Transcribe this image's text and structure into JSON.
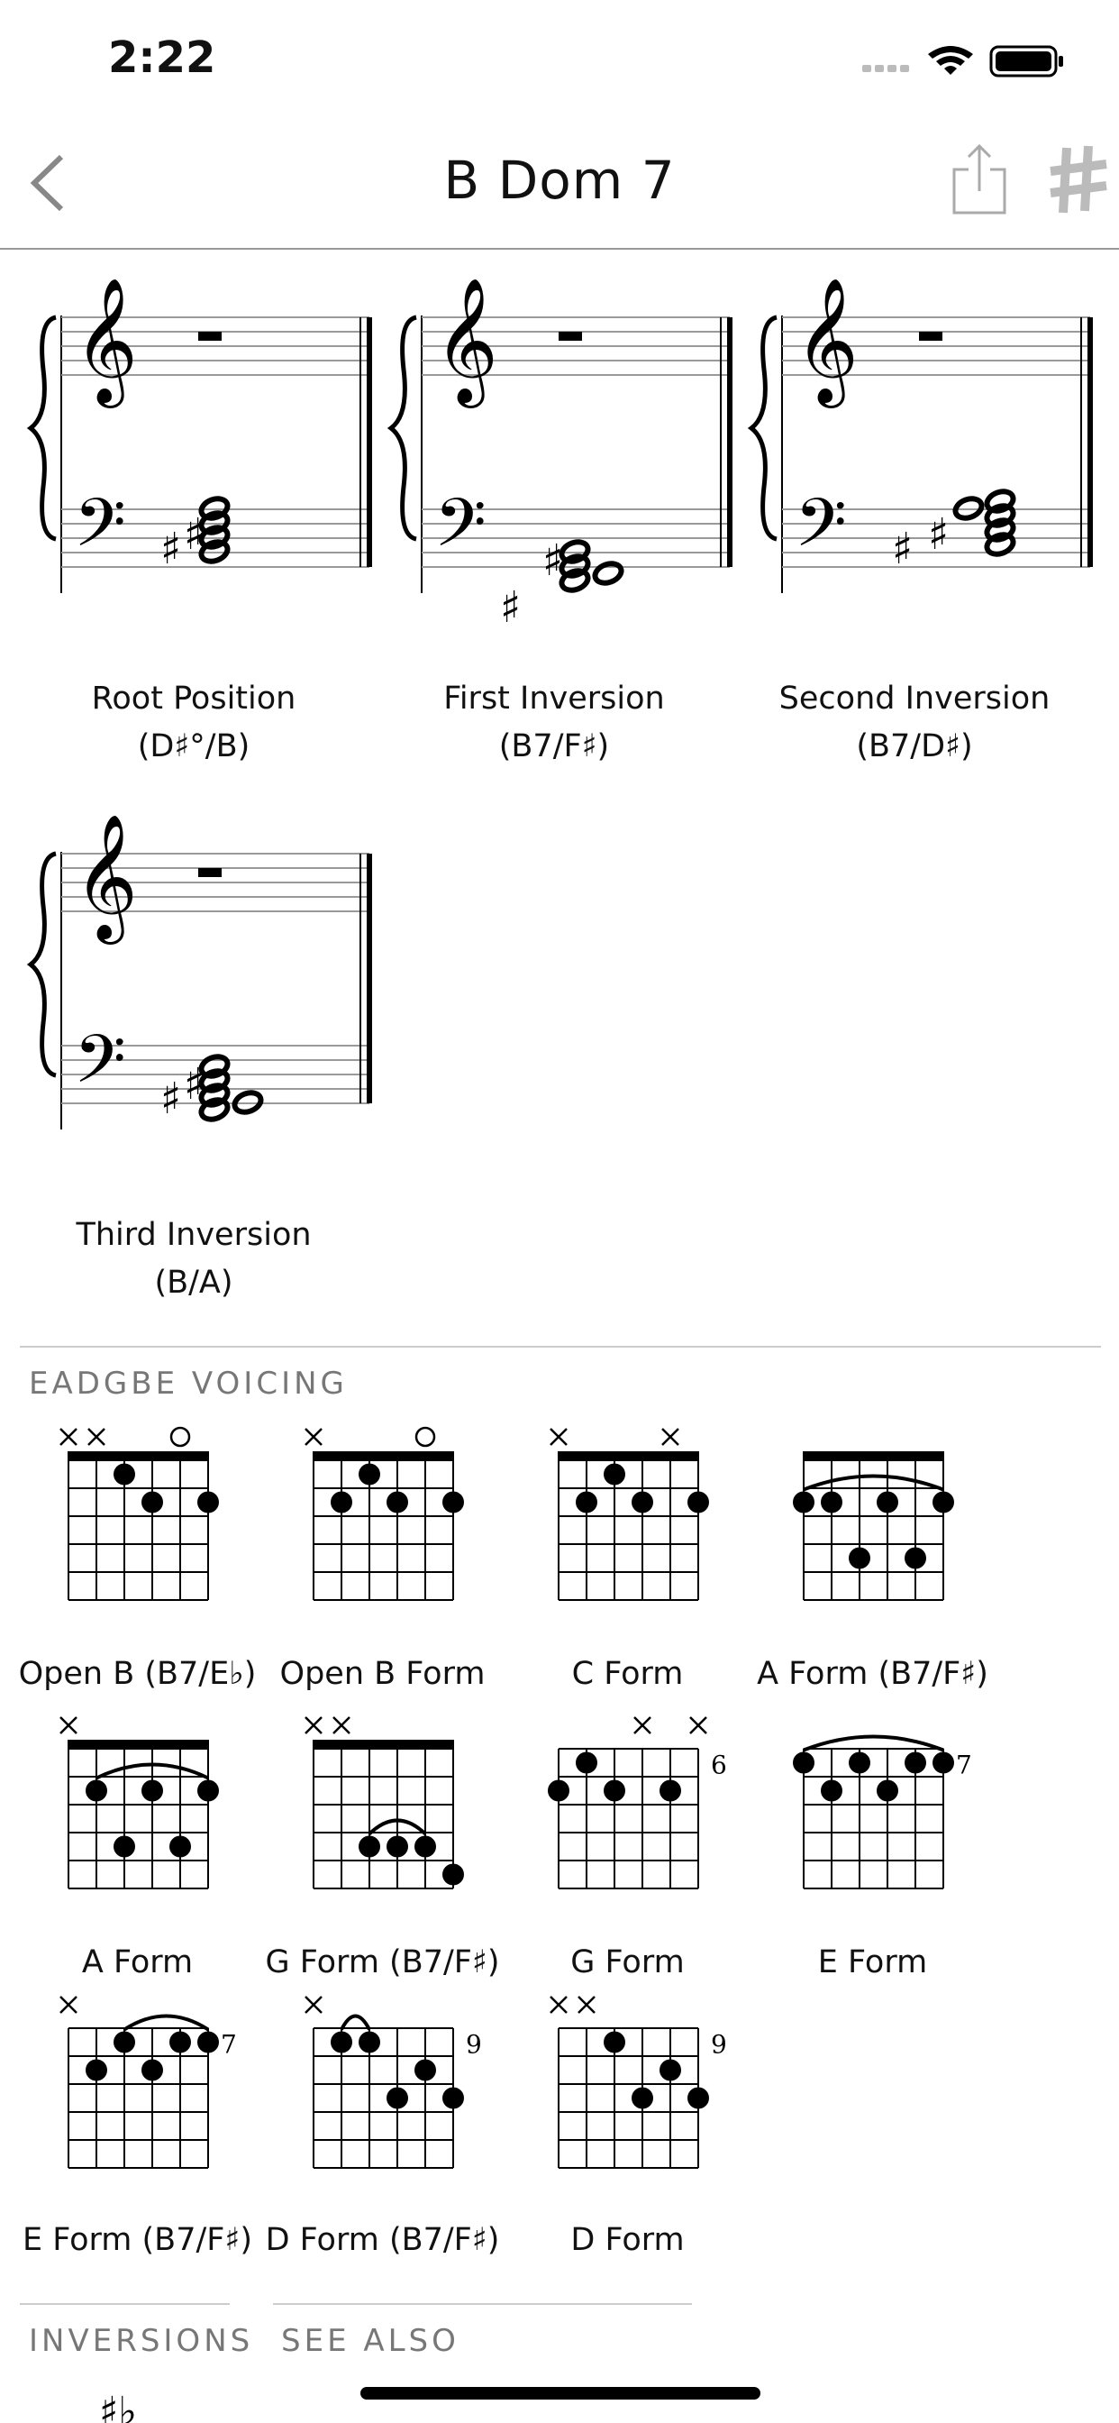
{
  "status": {
    "time": "2:22"
  },
  "nav": {
    "title": "B Dom 7"
  },
  "notation": [
    {
      "label": "Root Position",
      "sub": "(D♯°/B)"
    },
    {
      "label": "First Inversion",
      "sub": "(B7/F♯)"
    },
    {
      "label": "Second Inversion",
      "sub": "(B7/D♯)"
    },
    {
      "label": "Third Inversion",
      "sub": "(B/A)"
    }
  ],
  "voicing": {
    "title": "EADGBE VOICING",
    "chords": [
      {
        "label": "Open B (B7/E♭)",
        "fret": ""
      },
      {
        "label": "Open B Form",
        "fret": ""
      },
      {
        "label": "C Form",
        "fret": ""
      },
      {
        "label": "A Form (B7/F♯)",
        "fret": ""
      },
      {
        "label": "A Form",
        "fret": ""
      },
      {
        "label": "G Form (B7/F♯)",
        "fret": ""
      },
      {
        "label": "G Form",
        "fret": "6"
      },
      {
        "label": "E Form",
        "fret": "7"
      },
      {
        "label": "E Form (B7/F♯)",
        "fret": "7"
      },
      {
        "label": "D Form (B7/F♯)",
        "fret": "9"
      },
      {
        "label": "D Form",
        "fret": "9"
      }
    ]
  },
  "footer": {
    "inversions_title": "INVERSIONS",
    "see_also_title": "SEE ALSO"
  }
}
